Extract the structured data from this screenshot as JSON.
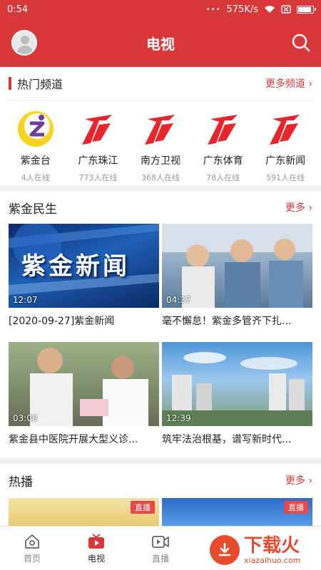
{
  "status_bar": {
    "time": "0:54",
    "dots": "•••",
    "speed": "575K/s"
  },
  "header": {
    "title": "电视"
  },
  "hot_channels": {
    "title": "热门频道",
    "more": "更多频道 ›",
    "items": [
      {
        "name": "紫金台",
        "viewers": "4人在线",
        "logo": "zijin-logo"
      },
      {
        "name": "广东珠江",
        "viewers": "773人在线",
        "logo": "gdtv-logo"
      },
      {
        "name": "南方卫视",
        "viewers": "368人在线",
        "logo": "gdtv-logo"
      },
      {
        "name": "广东体育",
        "viewers": "78人在线",
        "logo": "gdtv-logo"
      },
      {
        "name": "广东新闻",
        "viewers": "591人在线",
        "logo": "gdtv-logo"
      }
    ]
  },
  "zijin_minsheng": {
    "title": "紫金民生",
    "more": "更多 ›",
    "videos": [
      {
        "title": "[2020-09-27]紫金新闻",
        "duration": "12:07",
        "thumb_text": "紫金新闻"
      },
      {
        "title": "毫不懈怠！紫金多管齐下扎...",
        "duration": "04:37"
      },
      {
        "title": "紫金县中医院开展大型义诊...",
        "duration": "03:00"
      },
      {
        "title": "筑牢法治根基，谱写新时代...",
        "duration": "12:39"
      }
    ]
  },
  "rebo": {
    "title": "热播",
    "more": "更多 ›",
    "live_badge": "直播"
  },
  "bottom_nav": [
    {
      "label": "首页",
      "icon": "home-icon",
      "active": false
    },
    {
      "label": "电视",
      "icon": "tv-icon",
      "active": true
    },
    {
      "label": "直播",
      "icon": "video-icon",
      "active": false
    }
  ],
  "watermark": {
    "big": "下载火",
    "small": "xiazaihuo.com"
  },
  "colors": {
    "accent": "#d9383b"
  }
}
